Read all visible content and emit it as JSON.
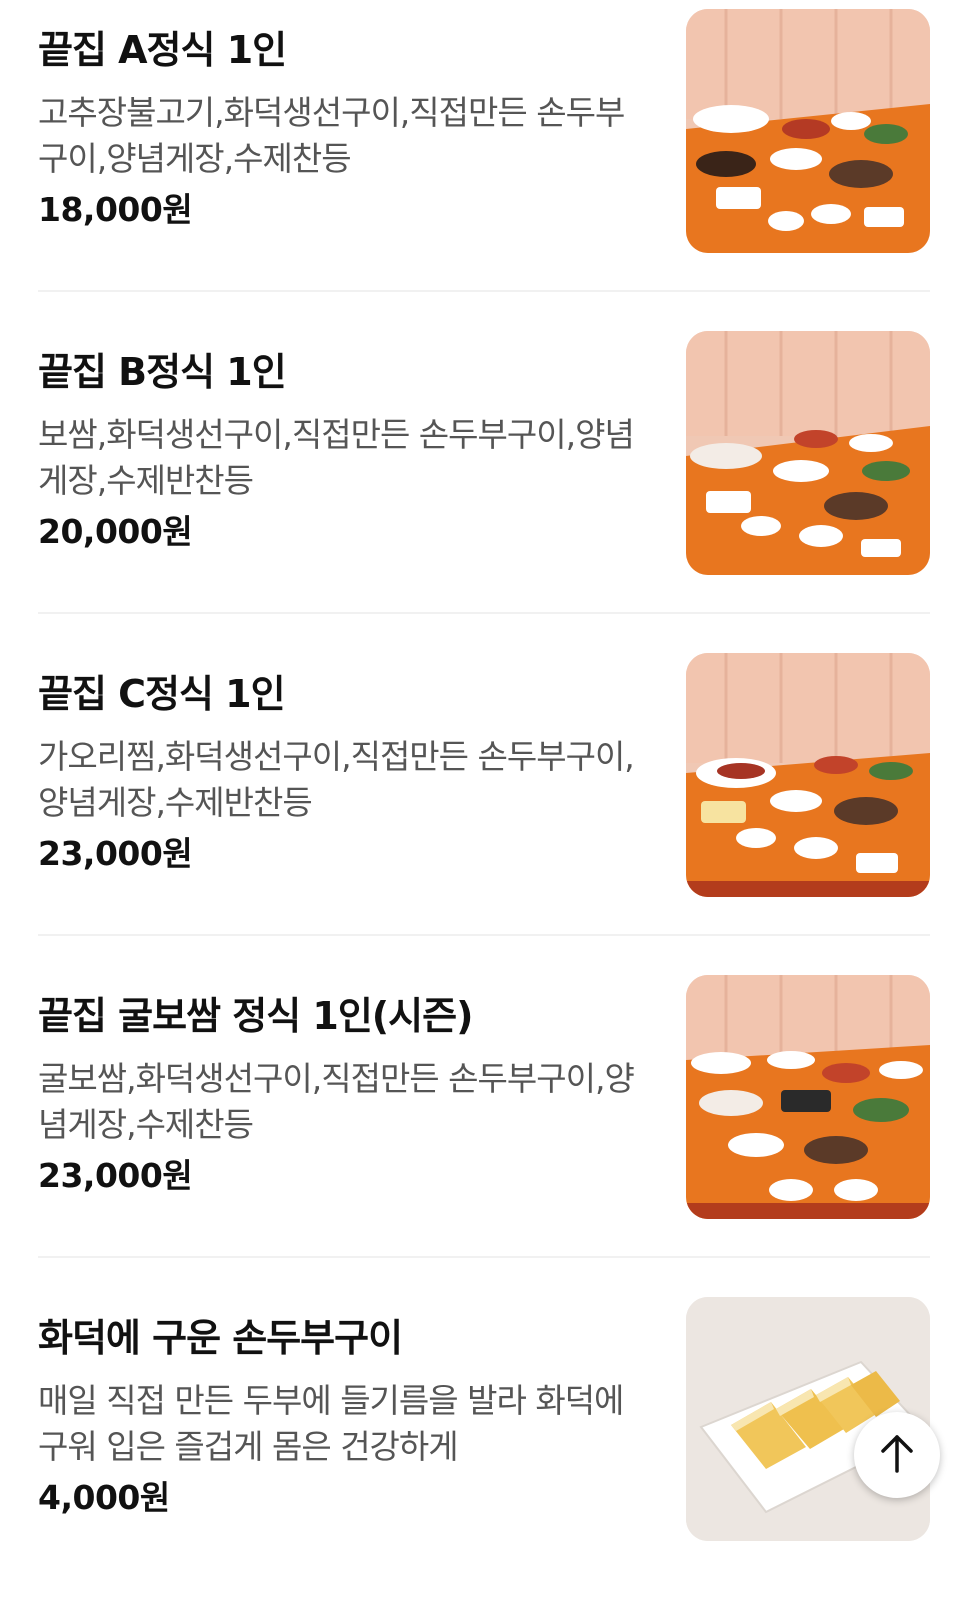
{
  "menu": {
    "items": [
      {
        "name": "끝집 A정식 1인",
        "description": "고추장불고기,화덕생선구이,직접만든 손두부구이,양념게장,수제찬등",
        "price": "18,000원",
        "photo_icon": "set-meal-photo"
      },
      {
        "name": "끝집 B정식 1인",
        "description": "보쌈,화덕생선구이,직접만든 손두부구이,양념게장,수제반찬등",
        "price": "20,000원",
        "photo_icon": "set-meal-photo"
      },
      {
        "name": "끝집 C정식 1인",
        "description": "가오리찜,화덕생선구이,직접만든 손두부구이,양념게장,수제반찬등",
        "price": "23,000원",
        "photo_icon": "set-meal-photo"
      },
      {
        "name": "끝집 굴보쌈 정식 1인(시즌)",
        "description": "굴보쌈,화덕생선구이,직접만든 손두부구이,양념게장,수제찬등",
        "price": "23,000원",
        "photo_icon": "set-meal-photo"
      },
      {
        "name": "화덕에 구운 손두부구이",
        "description": "매일 직접 만든 두부에 들기름을 발라 화덕에 구워 입은 즐겁게 몸은 건강하게",
        "price": "4,000원",
        "photo_icon": "grilled-tofu-photo"
      }
    ]
  },
  "scroll_top": {
    "icon": "arrow-up-icon"
  },
  "colors": {
    "title": "#111111",
    "description": "#555555",
    "divider": "#f1f1f1",
    "table_orange": "#e8761f",
    "wall_pink": "#f3c7b2"
  }
}
